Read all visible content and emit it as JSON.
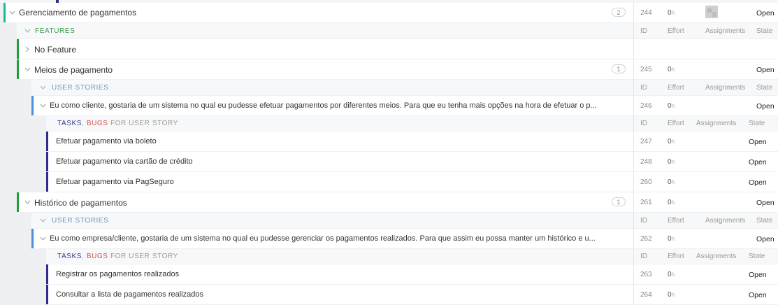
{
  "colors": {
    "epic": "#19b89b",
    "feature": "#1f9f3a",
    "story": "#4a90d9",
    "task": "#2e2e8a",
    "bug": "#d9534f",
    "header_text": "#7f9fbf"
  },
  "epic": {
    "title": "Gerenciamento de pagamentos",
    "badge": "2",
    "id": "244",
    "effort": "0",
    "effort_unit": "h",
    "state": "Open"
  },
  "features_header": {
    "label": "FEATURES",
    "col_id": "ID",
    "col_effort": "Effort",
    "col_assign": "Assignments",
    "col_state": "State"
  },
  "no_feature": {
    "title": "No Feature"
  },
  "feature1": {
    "title": "Meios de pagamento",
    "badge": "1",
    "id": "245",
    "effort": "0",
    "effort_unit": "h",
    "state": "Open"
  },
  "stories_header1": {
    "label": "USER STORIES",
    "col_id": "ID",
    "col_effort": "Effort",
    "col_assign": "Assignments",
    "col_state": "State"
  },
  "story1": {
    "title": "Eu como cliente, gostaria de um sistema no qual eu pudesse efetuar pagamentos por diferentes meios. Para que eu tenha mais opções na hora de efetuar o p...",
    "id": "246",
    "effort": "0",
    "effort_unit": "h",
    "state": "Open"
  },
  "tasks_header1": {
    "tasks": "TASKS",
    "sep": ",",
    "bugs": "BUGS",
    "suffix": "FOR USER STORY",
    "col_id": "ID",
    "col_effort": "Effort",
    "col_assign": "Assignments",
    "col_state": "State"
  },
  "tasks1": [
    {
      "title": "Efetuar pagamento via boleto",
      "id": "247",
      "effort": "0",
      "effort_unit": "h",
      "state": "Open"
    },
    {
      "title": "Efetuar pagamento via cartão de crédito",
      "id": "248",
      "effort": "0",
      "effort_unit": "h",
      "state": "Open"
    },
    {
      "title": "Efetuar pagamento via PagSeguro",
      "id": "260",
      "effort": "0",
      "effort_unit": "h",
      "state": "Open"
    }
  ],
  "feature2": {
    "title": "Histórico de pagamentos",
    "badge": "1",
    "id": "261",
    "effort": "0",
    "effort_unit": "h",
    "state": "Open"
  },
  "stories_header2": {
    "label": "USER STORIES",
    "col_id": "ID",
    "col_effort": "Effort",
    "col_assign": "Assignments",
    "col_state": "State"
  },
  "story2": {
    "title": "Eu como empresa/cliente, gostaria de um sistema no qual eu pudesse gerenciar os pagamentos realizados. Para que assim eu possa manter um histórico e u...",
    "id": "262",
    "effort": "0",
    "effort_unit": "h",
    "state": "Open"
  },
  "tasks_header2": {
    "tasks": "TASKS",
    "sep": ",",
    "bugs": "BUGS",
    "suffix": "FOR USER STORY",
    "col_id": "ID",
    "col_effort": "Effort",
    "col_assign": "Assignments",
    "col_state": "State"
  },
  "tasks2": [
    {
      "title": "Registrar os pagamentos realizados",
      "id": "263",
      "effort": "0",
      "effort_unit": "h",
      "state": "Open"
    },
    {
      "title": "Consultar a lista de pagamentos realizados",
      "id": "264",
      "effort": "0",
      "effort_unit": "h",
      "state": "Open"
    }
  ]
}
